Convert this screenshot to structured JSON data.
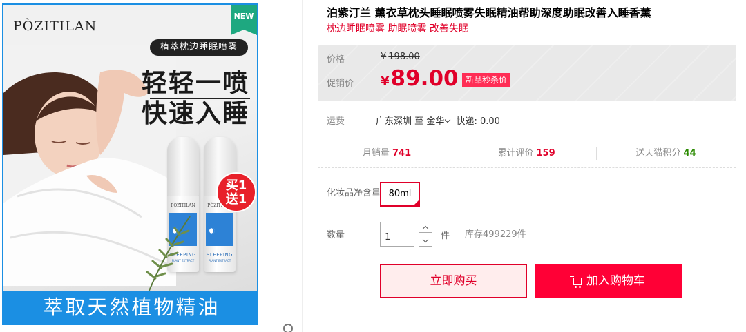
{
  "product_image": {
    "brand": "PÒZITILAN",
    "new_badge": "NEW",
    "tag": "植萃枕边睡眠喷雾",
    "headline_1": "轻轻一喷",
    "headline_2": "快速入睡",
    "bottle_brand": "PÒZITILAN",
    "bottle_text": "SLEEPING",
    "bottle_sub": "PLANT EXTRACT",
    "bogo_1": "买1",
    "bogo_2": "送1",
    "bottom_banner": "萃取天然植物精油"
  },
  "product": {
    "title": "泊紫汀兰 薰衣草枕头睡眠喷雾失眠精油帮助深度助眠改善入睡香薰",
    "subtitle": "枕边睡眠喷雾 助眠喷雾 改善失眠"
  },
  "price": {
    "original_label": "价格",
    "currency": "¥",
    "original": "198.00",
    "promo_label": "促销价",
    "promo": "89.00",
    "promo_tag": "新品秒杀价"
  },
  "shipping": {
    "label": "运费",
    "from": "广东深圳",
    "to_word": "至",
    "to": "金华",
    "express": "快递: 0.00"
  },
  "stats": {
    "monthly_sales_label": "月销量",
    "monthly_sales": "741",
    "reviews_label": "累计评价",
    "reviews": "159",
    "points_label": "送天猫积分",
    "points": "44"
  },
  "spec": {
    "label": "化妆品净含量",
    "option": "80ml"
  },
  "quantity": {
    "label": "数量",
    "value": "1",
    "unit": "件",
    "stock": "库存499229件"
  },
  "actions": {
    "buy_now": "立即购买",
    "add_to_cart": "加入购物车"
  },
  "colors": {
    "accent_red": "#e0002a",
    "cart_button": "#ff0036",
    "image_blue": "#1b8fe3"
  }
}
